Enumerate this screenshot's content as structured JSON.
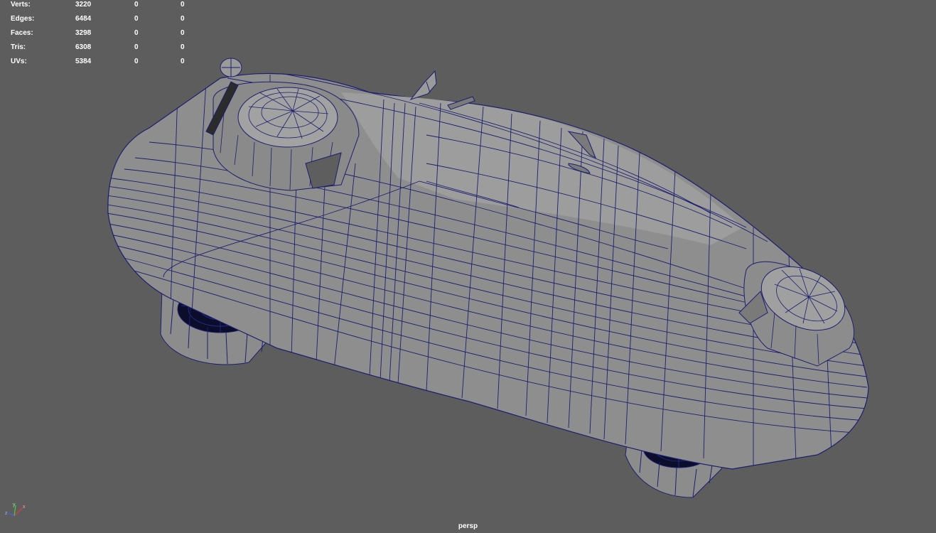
{
  "hud": {
    "rows": [
      {
        "label": "Verts:",
        "values": [
          "3220",
          "0",
          "0"
        ]
      },
      {
        "label": "Edges:",
        "values": [
          "6484",
          "0",
          "0"
        ]
      },
      {
        "label": "Faces:",
        "values": [
          "3298",
          "0",
          "0"
        ]
      },
      {
        "label": "Tris:",
        "values": [
          "6308",
          "0",
          "0"
        ]
      },
      {
        "label": "UVs:",
        "values": [
          "5384",
          "0",
          "0"
        ]
      }
    ]
  },
  "viewport": {
    "camera": "persp",
    "background_color": "#5d5d5d",
    "wire_color": "#1c1f6e",
    "surface_color": "#8f8f8f"
  },
  "axis_gizmo": {
    "labels": [
      "z",
      "y",
      "x"
    ],
    "colors": {
      "x": "#e04040",
      "y": "#40d040",
      "z": "#4060ff"
    }
  }
}
